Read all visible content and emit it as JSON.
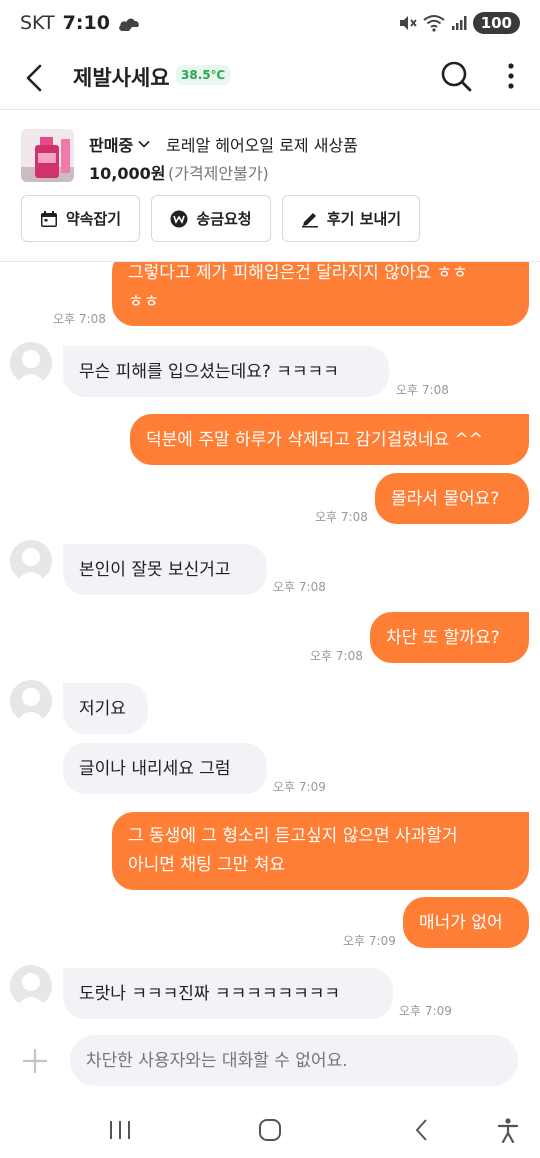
{
  "status_bar": {
    "carrier": "SKT",
    "time": "7:10",
    "battery": "100"
  },
  "header": {
    "title": "제발사세요",
    "temperature": "38.5℃"
  },
  "product": {
    "status": "판매중",
    "name": "로레알 헤어오일 로제 새상품",
    "price": "10,000원",
    "price_note": "(가격제안불가)",
    "actions": [
      {
        "label": "약속잡기",
        "icon": "calendar-icon"
      },
      {
        "label": "송금요청",
        "icon": "won-icon"
      },
      {
        "label": "후기 보내기",
        "icon": "pencil-icon"
      }
    ]
  },
  "messages": [
    {
      "side": "sent",
      "lines": [
        "그렇다고 제가 피해입은건 달라지지 않아요 ㅎㅎ",
        "ㅎㅎ"
      ],
      "time": "오후 7:08"
    },
    {
      "side": "recv",
      "text": "무슨 피해를 입으셨는데요? ㅋㅋㅋㅋ",
      "time": "오후 7:08"
    },
    {
      "side": "sent",
      "text": "덕분에 주말 하루가 삭제되고 감기걸렸네요 ^^",
      "time": ""
    },
    {
      "side": "sent",
      "text": "몰라서 물어요?",
      "time": "오후 7:08"
    },
    {
      "side": "recv",
      "text": "본인이 잘못 보신거고",
      "time": "오후 7:08"
    },
    {
      "side": "sent",
      "text": "차단 또 할까요?",
      "time": "오후 7:08"
    },
    {
      "side": "recv",
      "text": "저기요",
      "time": ""
    },
    {
      "side": "recv",
      "text": "글이나 내리세요 그럼",
      "time": "오후 7:09"
    },
    {
      "side": "sent",
      "lines": [
        "그 동생에 그 형소리 듣고싶지 않으면 사과할거",
        "아니면 채팅 그만 쳐요"
      ],
      "time": ""
    },
    {
      "side": "sent",
      "text": "매너가 없어",
      "time": "오후 7:09"
    },
    {
      "side": "recv",
      "text": "도랏나 ㅋㅋㅋ진짜 ㅋㅋㅋㅋㅋㅋㅋㅋ",
      "time": "오후 7:09"
    }
  ],
  "input": {
    "placeholder": "차단한 사용자와는 대화할 수 없어요."
  },
  "colors": {
    "accent": "#ff7e36",
    "bubble_recv": "#f2f3f6",
    "temperature": "#2aa851"
  }
}
